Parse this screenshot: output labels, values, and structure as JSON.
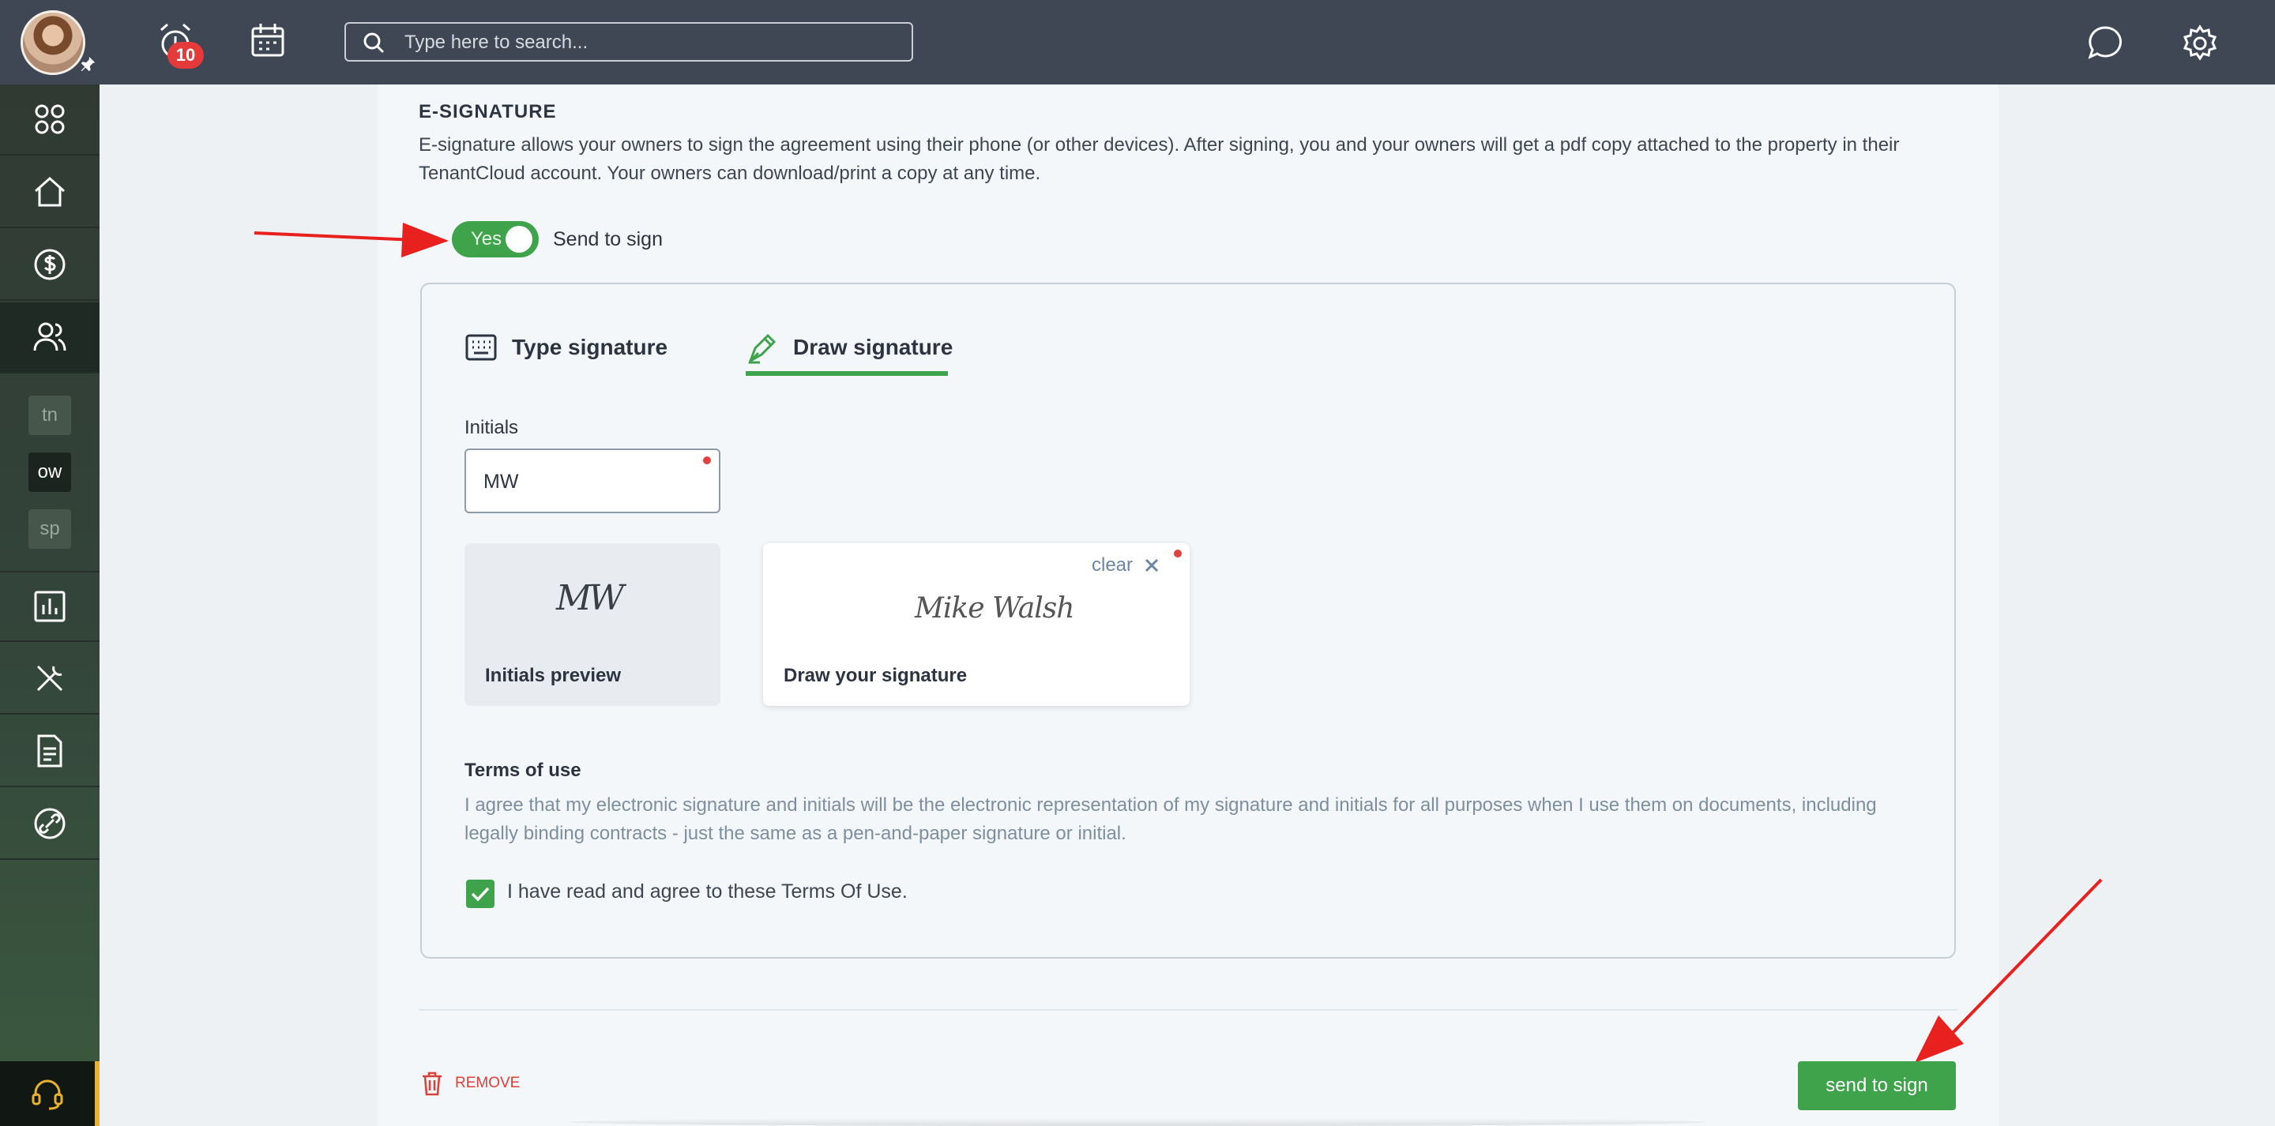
{
  "topbar": {
    "notification_count": "10",
    "search_placeholder": "Type here to search..."
  },
  "sidebar": {
    "chips": [
      "tn",
      "ow",
      "sp"
    ]
  },
  "esignature": {
    "title": "E-SIGNATURE",
    "description": "E-signature allows your owners to sign the agreement using their phone (or other devices). After signing, you and your owners will get a pdf copy attached to the property in their TenantCloud account. Your owners can download/print a copy at any time.",
    "toggle_value": "Yes",
    "toggle_label": "Send to sign",
    "tabs": [
      "Type signature",
      "Draw signature"
    ],
    "initials_label": "Initials",
    "initials_value": "MW",
    "initials_signature": "MW",
    "initials_preview_label": "Initials preview",
    "drawn_signature": "Mike Walsh",
    "draw_label": "Draw your signature",
    "clear_label": "clear",
    "terms_title": "Terms of use",
    "terms_text": "I agree that my electronic signature and initials will be the electronic representation of my signature and initials for all purposes when I use them on documents, including legally binding contracts - just the same as a pen-and-paper signature or initial.",
    "agree_label": "I have read and agree to these Terms Of Use.",
    "remove_label": "REMOVE",
    "send_button": "send to sign"
  },
  "colors": {
    "accent_green": "#3ea34a",
    "topbar": "#3e4753",
    "danger": "#d9413b",
    "annotation_arrow": "#e8201e"
  }
}
